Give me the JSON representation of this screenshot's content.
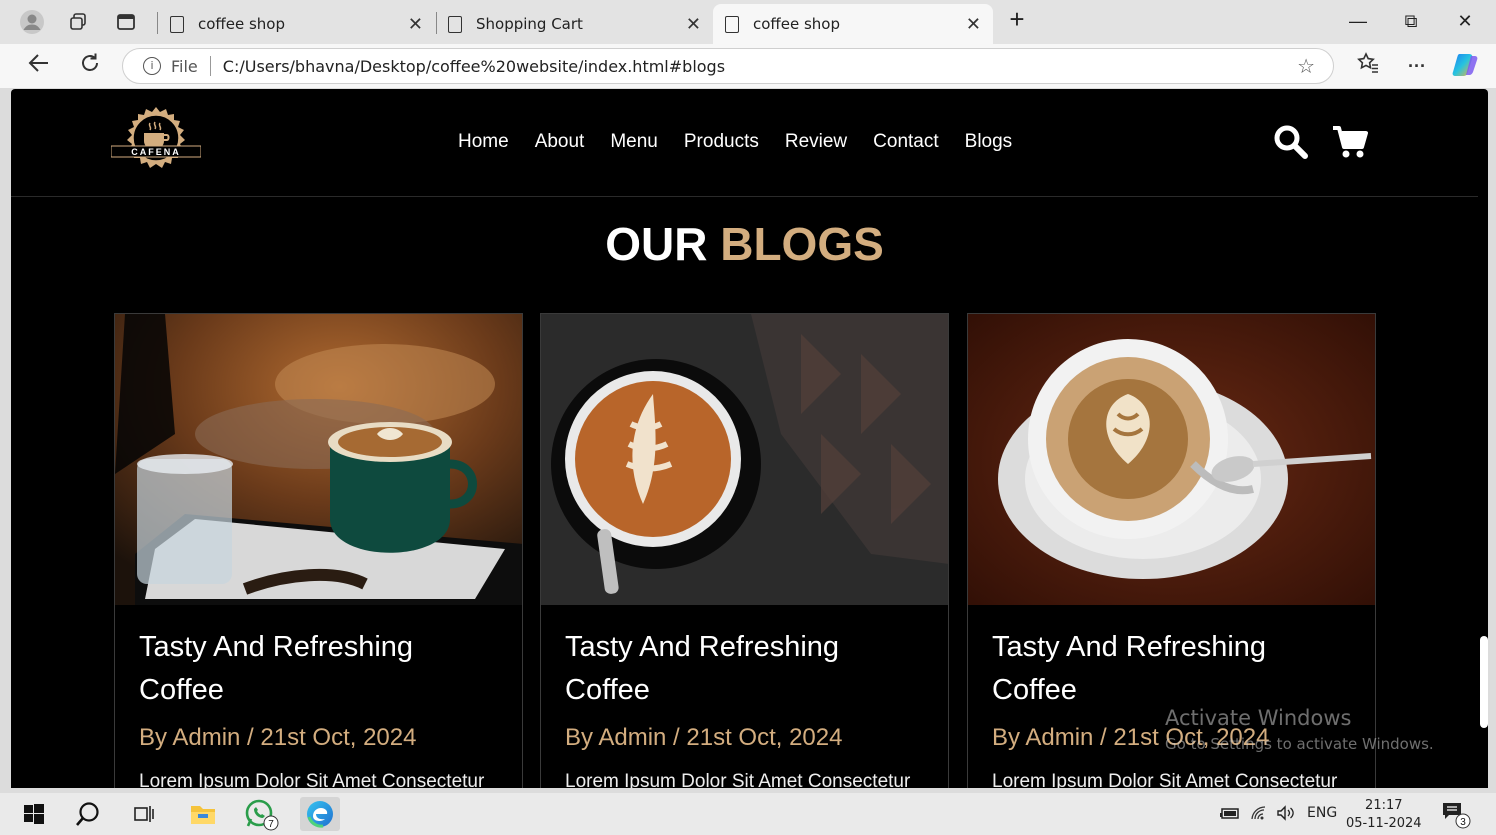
{
  "browser": {
    "tabs": [
      {
        "title": "coffee shop",
        "close": "✕"
      },
      {
        "title": "Shopping Cart",
        "close": "✕"
      },
      {
        "title": "coffee shop",
        "close": "✕"
      }
    ],
    "new_tab": "+",
    "window_controls": {
      "minimize": "—",
      "restore": "⧉",
      "close": "✕"
    },
    "address": {
      "scheme_label": "File",
      "url": "C:/Users/bhavna/Desktop/coffee%20website/index.html#blogs"
    },
    "more_label": "···"
  },
  "site": {
    "logo_text": "CAFENA",
    "nav": [
      "Home",
      "About",
      "Menu",
      "Products",
      "Review",
      "Contact",
      "Blogs"
    ],
    "section_title": {
      "part1": "OUR",
      "part2": "BLOGS"
    },
    "cards": [
      {
        "title": "Tasty And Refreshing Coffee",
        "meta": "By Admin / 21st Oct, 2024",
        "desc": "Lorem Ipsum Dolor Sit Amet Consectetur"
      },
      {
        "title": "Tasty And Refreshing Coffee",
        "meta": "By Admin / 21st Oct, 2024",
        "desc": "Lorem Ipsum Dolor Sit Amet Consectetur"
      },
      {
        "title": "Tasty And Refreshing Coffee",
        "meta": "By Admin / 21st Oct, 2024",
        "desc": "Lorem Ipsum Dolor Sit Amet Consectetur"
      }
    ],
    "accent_color": "#d3ad7f"
  },
  "watermark": {
    "line1": "Activate Windows",
    "line2": "Go to Settings to activate Windows."
  },
  "taskbar": {
    "whatsapp_badge": "7",
    "language": "ENG",
    "time": "21:17",
    "date": "05-11-2024",
    "notification_count": "3"
  }
}
